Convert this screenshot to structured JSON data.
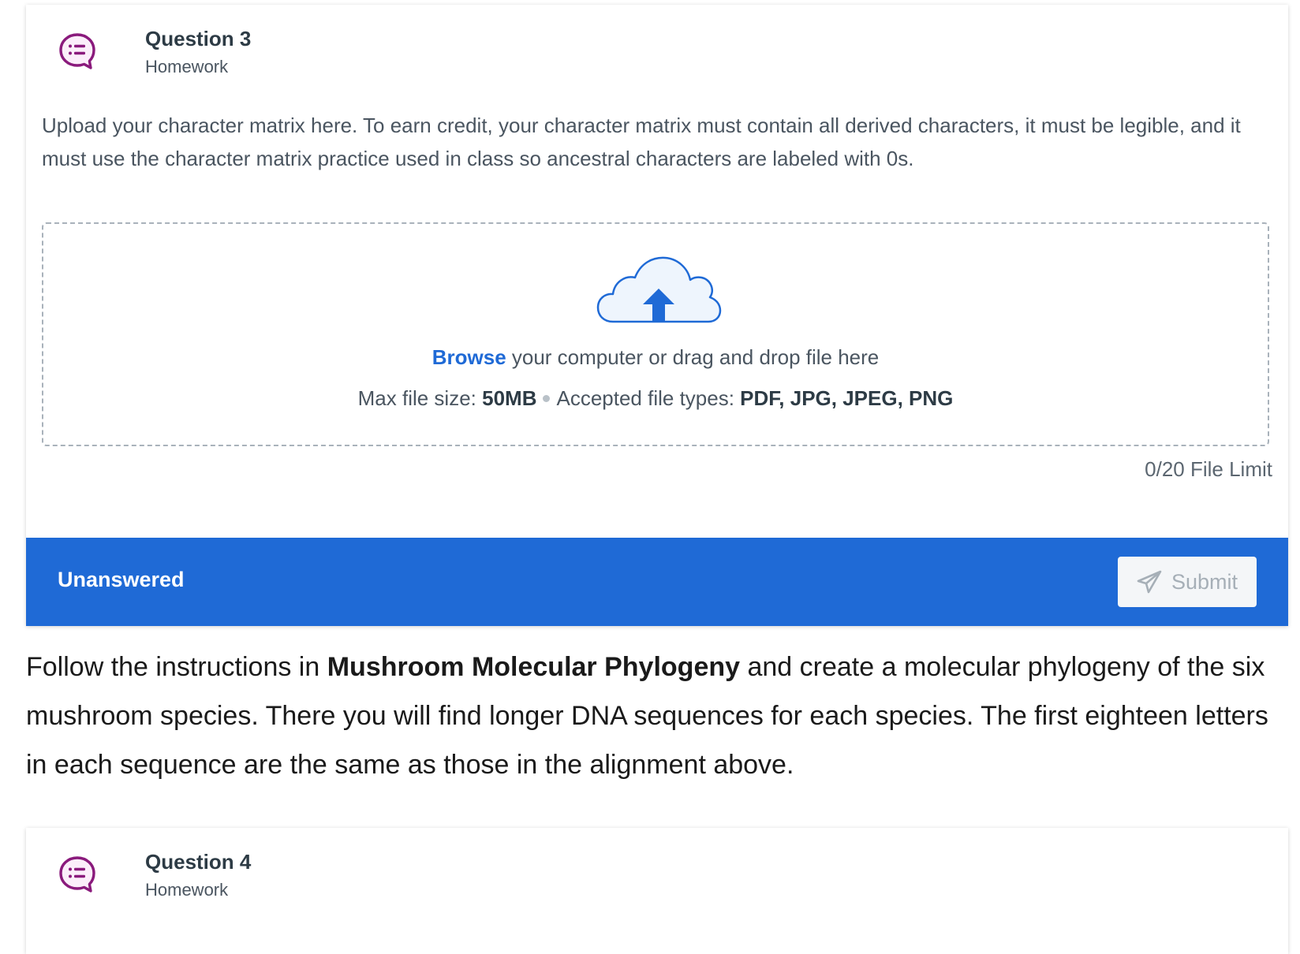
{
  "question3": {
    "title": "Question 3",
    "subtitle": "Homework",
    "icon": "question-chat-icon",
    "prompt": "Upload your character matrix here. To earn credit, your character matrix must contain all derived characters, it must be legible, and it must use the character matrix practice used in class so ancestral characters are labeled with 0s.",
    "upload": {
      "icon": "cloud-upload-icon",
      "browse_label": "Browse",
      "browse_rest": " your computer or drag and drop file here",
      "max_size_label": "Max file size: ",
      "max_size_value": "50MB",
      "types_label": "Accepted file types: ",
      "types_value": "PDF, JPG, JPEG, PNG"
    },
    "file_limit": "0/20 File Limit",
    "status": "Unanswered",
    "submit_label": "Submit",
    "submit_icon": "paper-plane-icon"
  },
  "narrative": {
    "part1": "Follow the instructions in ",
    "bold": "Mushroom Molecular Phylogeny",
    "part2": " and create a molecular phylogeny of the six mushroom species. There you will find longer DNA sequences for each species. The first eighteen letters in each sequence are the same as those in the alignment above."
  },
  "question4": {
    "title": "Question 4",
    "subtitle": "Homework",
    "icon": "question-chat-icon"
  },
  "colors": {
    "accent": "#1f6ad6",
    "icon_purple": "#8a1a7c",
    "text_muted": "#4a5560"
  }
}
